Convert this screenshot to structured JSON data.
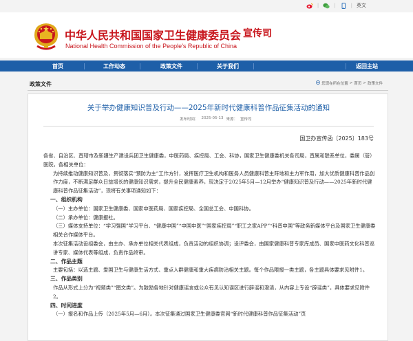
{
  "topbar": {
    "links": [
      {
        "icon": "weibo-icon"
      },
      {
        "icon": "wechat-icon"
      },
      {
        "icon": "mobile-icon"
      }
    ],
    "lang_label": "英文"
  },
  "header": {
    "title_cn": "中华人民共和国国家卫生健康委员会",
    "dept": "宣传司",
    "title_en": "National Health Commission of the People’s Republic of China",
    "colors": {
      "brand_red": "#c8161d"
    }
  },
  "nav": {
    "items": [
      "首页",
      "工作动态",
      "政策文件",
      "关于我们"
    ],
    "active_index": 2,
    "back_label": "返回主站",
    "colors": {
      "bar": "#1e5fa8"
    }
  },
  "breadcrumb": {
    "section_title": "政策文件",
    "path": [
      "您现在所在位置",
      "首页",
      "政策文件"
    ]
  },
  "article": {
    "title": "关于举办健康知识普及行动——2025年新时代健康科普作品征集活动的通知",
    "date_label": "发布时间：",
    "date": "2025-05-13",
    "source_label": "来源：",
    "source": "宣传司",
    "doc_number": "国卫办宣传函〔2025〕183号",
    "paragraphs": [
      "各省、自治区、直辖市及新疆生产建设兵团卫生健康委，中医药局、疾控局、工会、科协，国家卫生健康委机关各司局，直属和联系单位，委属（管）医院，各相关单位：",
      "为持续推动健康知识普及，贯彻落实“预防为主”工作方针，发挥医疗卫生机构和医务人员健康科普主阵地和主力军作用，加大优质健康科普作品创作力度，不断满足群众日益增长的健康知识需求，提升全民健康素养，现决定于2025年5月—12月举办“健康知识普及行动——2025年新时代健康科普作品征集活动”，现将有关事项通知如下：",
      "一、组织机构",
      "（一）主办单位：国家卫生健康委、国家中医药局、国家疾控局、全国总工会、中国科协。",
      "（二）承办单位：健康报社。",
      "（三）媒体支持单位：“学习强国”学习平台、“健康中国”“中国中医”“国家疾控局”“职工之家APP”“科普中国”等政务新媒体平台及国家卫生健康委相关合作媒体平台。",
      "本次征集活动设组委会，由主办、承办单位相关代表组成，负责活动的组织协调；设评委会，由国家健康科普专家库成员、国家中医药文化科普巡讲专家、媒体代表等组成，负责作品终审。",
      "二、作品主题",
      "主要包括：以选主题、爱国卫生与健康生活方式、重点人群健康和重大疾病防治相关主题。每个作品限报一类主题，各主题具体要求见附件1。",
      "三、作品类别",
      "作品从形式上分为“视频类”“图文类”。为鼓励各地针对健康谣言或公众有见认知误区进行辟谣和澄清，从内容上专设“辟谣类”，具体要求见附件2。",
      "四、时间进度",
      "（一）报名和作品上传（2025年5月—6月）。本次征集通过国家卫生健康委官网“新时代健康科普作品征集活动”页"
    ]
  }
}
